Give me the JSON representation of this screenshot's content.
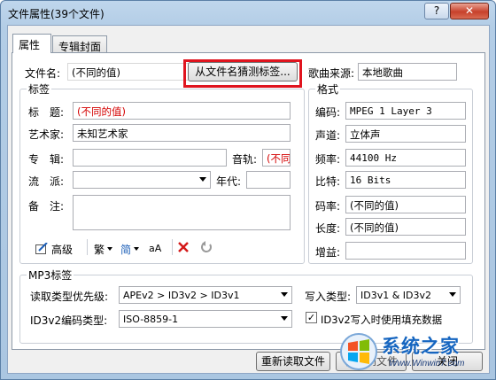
{
  "window": {
    "title": "文件属性(39个文件)",
    "help_label": "?",
    "close_label": "✕"
  },
  "tabs": [
    {
      "label": "属性",
      "active": true
    },
    {
      "label": "专辑封面",
      "active": false
    }
  ],
  "filename": {
    "label": "文件名:",
    "value": "(不同的值)"
  },
  "guess_button": {
    "label": "从文件名猜测标签..."
  },
  "song_source": {
    "label": "歌曲来源:",
    "value": "本地歌曲"
  },
  "tag_group": {
    "title": "标签",
    "title_field": {
      "label": "标　题:",
      "value": "(不同的值)"
    },
    "artist_field": {
      "label": "艺术家:",
      "value": "未知艺术家"
    },
    "album_field": {
      "label": "专　辑:",
      "value": ""
    },
    "track_field": {
      "label": "音轨:",
      "value": "(不同"
    },
    "genre_field": {
      "label": "流　派:",
      "value": ""
    },
    "year_field": {
      "label": "年代:",
      "value": ""
    },
    "comment_field": {
      "label": "备　注:",
      "value": ""
    },
    "toolbar": {
      "advanced_label": "高级",
      "trad_label": "繁",
      "simp_label": "简",
      "case_label": "aA",
      "delete_icon": "red-x",
      "undo_icon": "undo-arrow"
    }
  },
  "format_group": {
    "title": "格式",
    "rows": [
      {
        "label": "编码:",
        "value": "MPEG 1 Layer 3",
        "mono": true
      },
      {
        "label": "声道:",
        "value": "立体声",
        "mono": false
      },
      {
        "label": "频率:",
        "value": "44100 Hz",
        "mono": true
      },
      {
        "label": "比特:",
        "value": "16 Bits",
        "mono": true
      },
      {
        "label": "码率:",
        "value": "(不同的值)",
        "mono": false
      },
      {
        "label": "长度:",
        "value": "(不同的值)",
        "mono": false
      },
      {
        "label": "增益:",
        "value": "",
        "mono": false
      }
    ]
  },
  "mp3_group": {
    "title": "MP3标签",
    "read_priority": {
      "label": "读取类型优先级:",
      "value": "APEv2 > ID3v2 > ID3v1"
    },
    "write_type": {
      "label": "写入类型:",
      "value": "ID3v1 & ID3v2"
    },
    "id3v2_encoding": {
      "label": "ID3v2编码类型:",
      "value": "ISO-8859-1"
    },
    "padding_checkbox": {
      "label": "ID3v2写入时使用填充数据",
      "checked": true
    }
  },
  "footer": {
    "reload_label": "重新读取文件",
    "save_label": "保存到文件",
    "close_label": "关闭"
  },
  "watermark": {
    "title": "系统之家",
    "url": "Www.Winwin7.com"
  },
  "colors": {
    "highlight_border": "#e0141e",
    "different_value_text": "#d40000",
    "titlebar": "#bfd6ec"
  }
}
